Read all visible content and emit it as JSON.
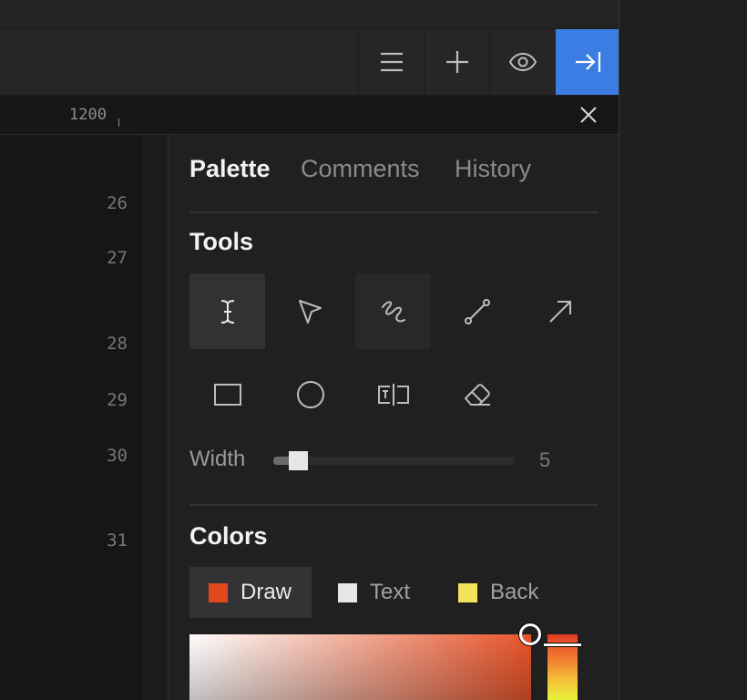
{
  "ruler": {
    "label": "1200"
  },
  "line_numbers": [
    "26",
    "27",
    "28",
    "29",
    "30",
    "31"
  ],
  "toolbar": {
    "icons": [
      "hamburger-menu-icon",
      "plus-icon",
      "eye-icon",
      "collapse-panel-icon"
    ],
    "accent_color": "#3b7de3"
  },
  "panel": {
    "tabs": [
      "Palette",
      "Comments",
      "History"
    ],
    "active_tab": "Palette",
    "tools_title": "Tools",
    "tools": [
      {
        "name": "text-cursor-tool",
        "selected": true
      },
      {
        "name": "pointer-tool",
        "selected": false
      },
      {
        "name": "freehand-tool",
        "selected": false
      },
      {
        "name": "line-tool",
        "selected": false
      },
      {
        "name": "arrow-tool",
        "selected": false
      },
      {
        "name": "rectangle-tool",
        "selected": false
      },
      {
        "name": "ellipse-tool",
        "selected": false
      },
      {
        "name": "text-box-tool",
        "selected": false
      },
      {
        "name": "eraser-tool",
        "selected": false
      }
    ],
    "width_label": "Width",
    "width_value": "5",
    "colors_title": "Colors",
    "color_targets": [
      {
        "label": "Draw",
        "color": "#e04a1e",
        "selected": true
      },
      {
        "label": "Text",
        "color": "#e6e6e6",
        "selected": false
      },
      {
        "label": "Back",
        "color": "#f2e35a",
        "selected": false
      }
    ]
  }
}
